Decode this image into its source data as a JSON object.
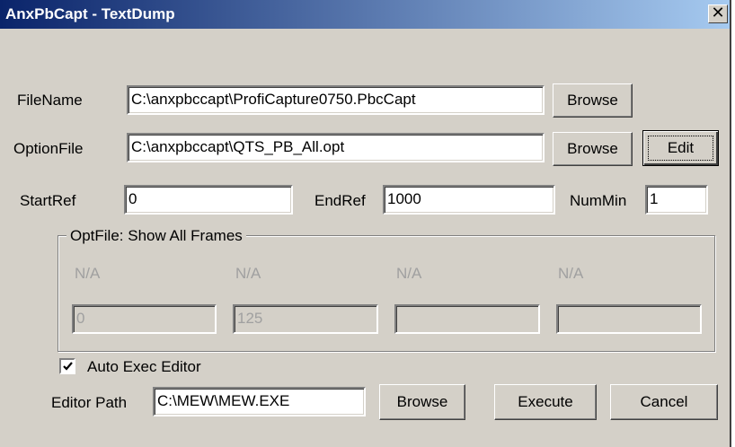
{
  "window": {
    "title": "AnxPbCapt - TextDump",
    "close_glyph": "✕"
  },
  "filename": {
    "label": "FileName",
    "value": "C:\\anxpbccapt\\ProfiCapture0750.PbcCapt",
    "browse_label": "Browse"
  },
  "optionfile": {
    "label": "OptionFile",
    "value": "C:\\anxpbccapt\\QTS_PB_All.opt",
    "browse_label": "Browse",
    "edit_label": "Edit"
  },
  "range": {
    "startref_label": "StartRef",
    "startref_value": "0",
    "endref_label": "EndRef",
    "endref_value": "1000",
    "nummin_label": "NumMin",
    "nummin_value": "1"
  },
  "optfile_group": {
    "title": "OptFile:  Show All Frames",
    "columns": [
      {
        "label": "N/A",
        "value": "0"
      },
      {
        "label": "N/A",
        "value": "125"
      },
      {
        "label": "N/A",
        "value": ""
      },
      {
        "label": "N/A",
        "value": ""
      }
    ]
  },
  "auto_exec": {
    "label": "Auto Exec Editor",
    "checked": true
  },
  "editor": {
    "label": "Editor Path",
    "value": "C:\\MEW\\MEW.EXE",
    "browse_label": "Browse"
  },
  "actions": {
    "execute_label": "Execute",
    "cancel_label": "Cancel"
  },
  "icons": {
    "close": "close-icon",
    "check": "checkmark-icon"
  }
}
